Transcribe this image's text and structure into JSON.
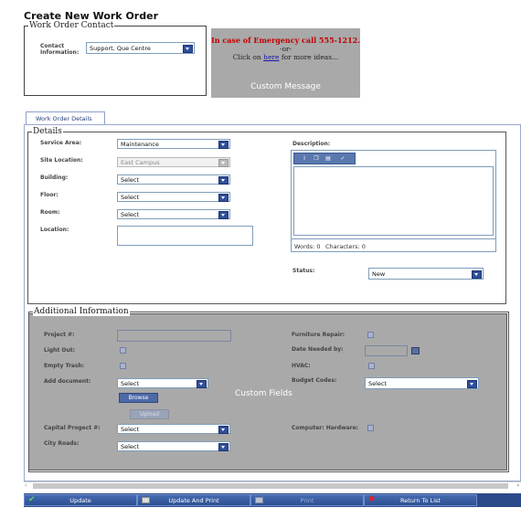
{
  "page": {
    "title": "Create New Work Order"
  },
  "work_order_contact": {
    "legend": "Work Order Contact",
    "label": "Contact Information:",
    "value": "Support, Que Centre"
  },
  "emergency": {
    "line1": "In case of Emergency call 555-1212.",
    "line2": "-or-",
    "line3_before": "Click on ",
    "line3_link": "here",
    "line3_after": " for more ideas...",
    "caption": "Custom Message"
  },
  "tabs": [
    {
      "label": "Work Order Details"
    }
  ],
  "details": {
    "legend": "Details",
    "service_area": {
      "label": "Service Area:",
      "value": "Maintenance"
    },
    "site_location": {
      "label": "Site Location:",
      "value": "East Campus"
    },
    "building": {
      "label": "Building:",
      "value": "Select"
    },
    "floor": {
      "label": "Floor:",
      "value": "Select"
    },
    "room": {
      "label": "Room:",
      "value": "Select"
    },
    "location": {
      "label": "Location:",
      "value": ""
    },
    "description": {
      "label": "Description:",
      "words": "Words: 0",
      "characters": "Characters: 0"
    },
    "status": {
      "label": "Status:",
      "value": "New"
    }
  },
  "additional": {
    "legend": "Additional Information",
    "custom_fields": "Custom Fields",
    "project": {
      "label": "Project #:",
      "value": ""
    },
    "light_out": {
      "label": "Light Out:"
    },
    "empty_trash": {
      "label": "Empty Trash:"
    },
    "add_document": {
      "label": "Add document:",
      "value": "Select",
      "browse": "Browse",
      "upload": "Upload"
    },
    "capital_project": {
      "label": "Capital Progect #:",
      "value": "Select"
    },
    "city_roads": {
      "label": "City Roads:",
      "value": "Select"
    },
    "furniture_repair": {
      "label": "Furniture Repair:"
    },
    "date_needed": {
      "label": "Date Needed by:",
      "value": ""
    },
    "hvac": {
      "label": "HVAC:"
    },
    "budget_codes": {
      "label": "Budget Codes:",
      "value": "Select"
    },
    "computer_hardware": {
      "label": "Computer: Hardware:"
    }
  },
  "actions": {
    "update": "Update",
    "update_print": "Update And Print",
    "print": "Print",
    "return": "Return To List"
  },
  "colors": {
    "accent": "#2c4a8a",
    "emergency_red": "#c00000",
    "panel_gray": "#a9a9a9"
  }
}
